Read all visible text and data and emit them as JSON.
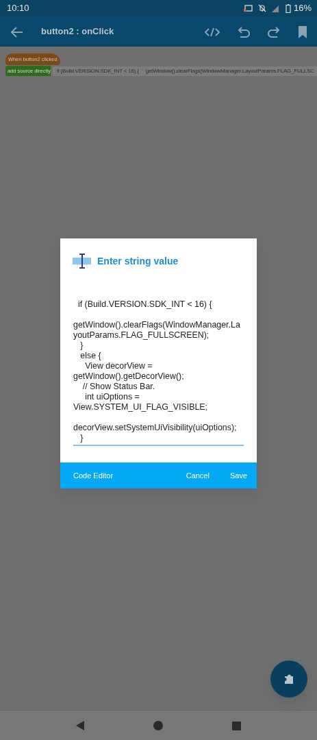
{
  "status_bar": {
    "time": "10:10",
    "battery": "16%"
  },
  "app_bar": {
    "title": "button2 : onClick"
  },
  "blocks": [
    {
      "kind": "event",
      "label": "When button2 clicked"
    },
    {
      "kind": "source",
      "label": "add source directly",
      "field": [
        "if (Build.VERSION.SDK_INT < 16) {",
        "getWindow().clearFlags(WindowManager.LayoutParams.FLAG_FULLSC"
      ]
    }
  ],
  "dialog": {
    "title": "Enter string value",
    "value": "\n  if (Build.VERSION.SDK_INT < 16) {\n\ngetWindow().clearFlags(WindowManager.LayoutParams.FLAG_FULLSCREEN);\n   }\n   else {\n     View decorView =\ngetWindow().getDecorView();\n    // Show Status Bar.\n     int uiOptions =\nView.SYSTEM_UI_FLAG_VISIBLE;\n\ndecorView.setSystemUiVisibility(uiOptions);\n   }",
    "buttons": [
      {
        "label": "Code Editor",
        "kind": "left"
      },
      {
        "label": "Cancel",
        "kind": "right"
      },
      {
        "label": "Save",
        "kind": "right"
      }
    ]
  }
}
